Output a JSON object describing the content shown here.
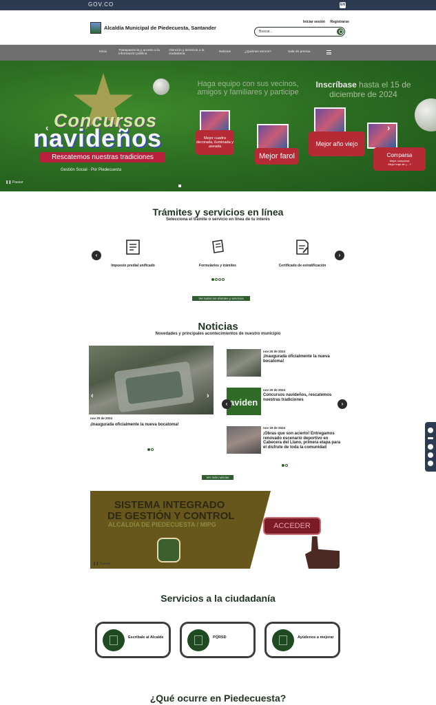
{
  "gov": {
    "logo": "GOV.CO",
    "lang": "EN"
  },
  "header": {
    "brand": "Alcaldía Municipal de Piedecuesta, Santander",
    "login": "Iniciar sesión",
    "register": "Registrarse",
    "search_placeholder": "Buscar..."
  },
  "nav": {
    "items": [
      "Inicio",
      "Transparencia y acceso a la información pública",
      "Atención y servicios a la ciudadanía",
      "Noticias",
      "¿Quiénes somos?",
      "Sala de prensa"
    ]
  },
  "hero": {
    "title_top": "Concursos",
    "title_main": "navideños",
    "ribbon": "Rescatemos nuestras tradiciones",
    "sub": "Haga equipo con sus vecinos, amigos y familiares y participe",
    "date_strong": "Inscríbase",
    "date_rest": "hasta el 15 de diciembre de 2024",
    "prize1": "Mejor cuadra decorada, iluminada y aseada",
    "prize2": "Mejor farol",
    "prize3": "Mejor año viejo",
    "prize4": "Comparsa",
    "prize4_sub1": "Mejor comparsa",
    "prize4_sub2": "Mejor traje de ¿...?",
    "logos": "Gestión Social · Por Piedecuesta",
    "pause": "Pausar"
  },
  "tramites": {
    "title": "Trámites y servicios en línea",
    "subtitle": "Selecciona el trámite o servicio en línea de tu interés",
    "items": [
      {
        "label": "Impuesto predial unificado",
        "icon": "receipt-icon"
      },
      {
        "label": "Formularios y trámites",
        "icon": "forms-icon"
      },
      {
        "label": "Certificado de estratificación",
        "icon": "certificate-icon"
      }
    ],
    "see_all": "Ver todos los trámites y servicios"
  },
  "news": {
    "title": "Noticias",
    "subtitle": "Novedades y principales acontecimientos de nuestro municipio",
    "main": {
      "date": "nov 20 de 2024",
      "headline": "¡Inaugurada oficialmente la nueva bocatoma!"
    },
    "list": [
      {
        "date": "nov 20 de 2024",
        "headline": "¡Inaugurada oficialmente la nueva bocatoma!"
      },
      {
        "date": "nov 20 de 2024",
        "headline": "Concursos navideños, rescatemos nuestras tradiciones"
      },
      {
        "date": "nov 19 de 2024",
        "headline": "¡Obras que son acierto! Entregamos renovado escenario deportivo en Cabecera del Llano, primera etapa para el disfrute de toda la comunidad"
      }
    ],
    "thumb_text": "aviden",
    "see_all": "Ver más noticias"
  },
  "sigc": {
    "line1": "SISTEMA INTEGRADO",
    "line2": "DE GESTIÓN Y CONTROL",
    "line3": "ALCALDÍA DE PIEDECUESTA / MIPG",
    "button": "ACCEDER",
    "pause": "Pausar"
  },
  "services": {
    "title": "Servicios a la ciudadanía",
    "items": [
      {
        "label": "Escríbale al Alcalde",
        "icon": "letter-icon"
      },
      {
        "label": "PQRSD",
        "icon": "document-icon"
      },
      {
        "label": "Ayúdenos a mejorar",
        "icon": "hands-icon"
      }
    ]
  },
  "whats_on": {
    "title": "¿Qué ocurre en Piedecuesta?"
  },
  "colors": {
    "primary": "#2f5d2f",
    "gov_bar": "#2c3b52",
    "nav": "#6f6f6f",
    "hero": "#2c6e22"
  }
}
